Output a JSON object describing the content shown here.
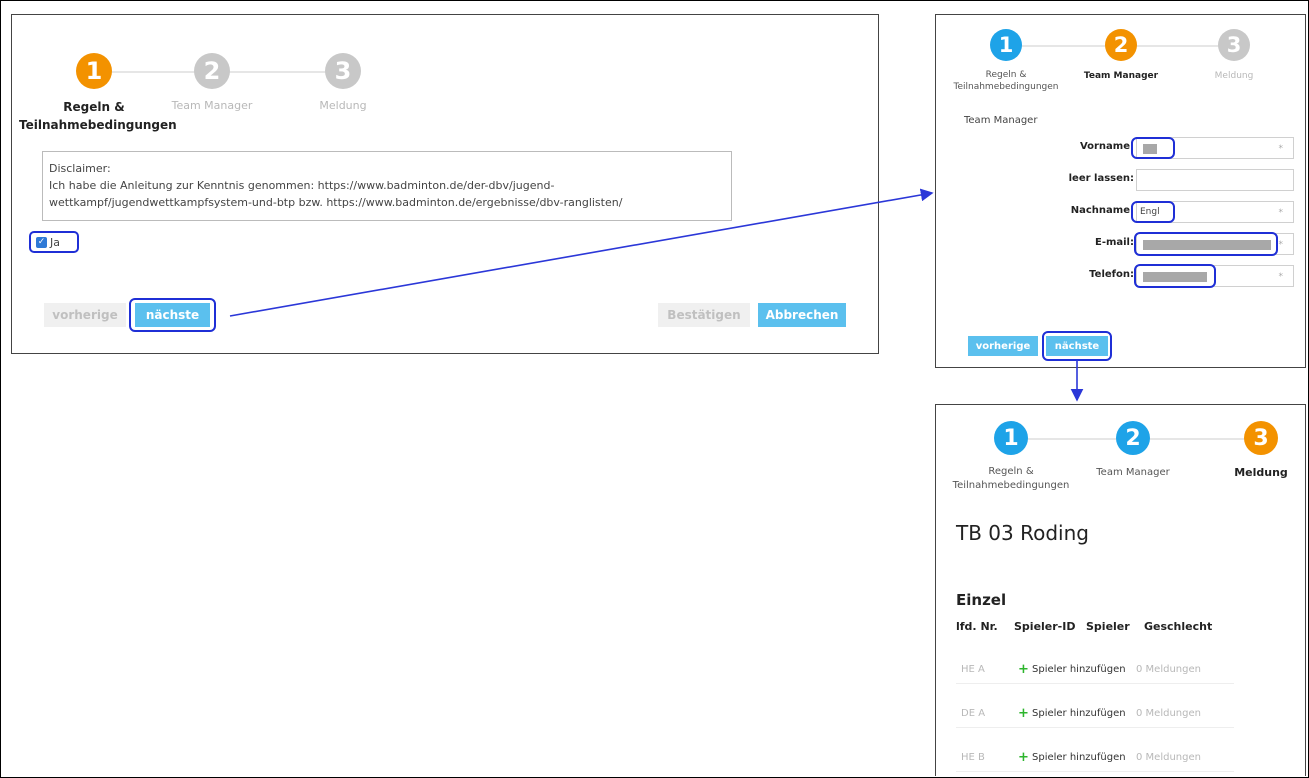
{
  "step_labels": {
    "step1": "Regeln & Teilnahmebedingungen",
    "step2": "Team Manager",
    "step3": "Meldung",
    "step1_line1": "Regeln &",
    "step1_line2": "Teilnahmebedingungen"
  },
  "step_numbers": [
    "1",
    "2",
    "3"
  ],
  "panel1": {
    "disclaimer_title": "Disclaimer:",
    "disclaimer_text_line1": "Ich habe die Anleitung zur Kenntnis genommen: https://www.badminton.de/der-dbv/jugend-",
    "disclaimer_text_line2": "wettkampf/jugendwettkampfsystem-und-btp bzw. https://www.badminton.de/ergebnisse/dbv-ranglisten/",
    "checkbox_label": "Ja",
    "checkbox_checked": true,
    "btn_prev": "vorherige",
    "btn_next": "nächste",
    "btn_confirm": "Bestätigen",
    "btn_cancel": "Abbrechen"
  },
  "panel2": {
    "section_title": "Team Manager",
    "fields": {
      "vorname_label": "Vorname:",
      "leer_label": "leer lassen:",
      "nachname_label": "Nachname:",
      "nachname_value": "Engl",
      "email_label": "E-mail:",
      "telefon_label": "Telefon:"
    },
    "required_mark": "*",
    "btn_prev": "vorherige",
    "btn_next": "nächste"
  },
  "panel3": {
    "club_name": "TB 03 Roding",
    "section": "Einzel",
    "columns": [
      "lfd. Nr.",
      "Spieler-ID",
      "Spieler",
      "Geschlecht"
    ],
    "rows": [
      {
        "code": "HE A",
        "action": "Spieler hinzufügen",
        "count": "0 Meldungen"
      },
      {
        "code": "DE A",
        "action": "Spieler hinzufügen",
        "count": "0 Meldungen"
      },
      {
        "code": "HE B",
        "action": "Spieler hinzufügen",
        "count": "0 Meldungen"
      }
    ]
  },
  "colors": {
    "orange": "#f39200",
    "blue": "#1ea3e8",
    "grey": "#c8c8c8",
    "button_blue": "#5bc0ee",
    "highlight": "#1f2fd6"
  }
}
